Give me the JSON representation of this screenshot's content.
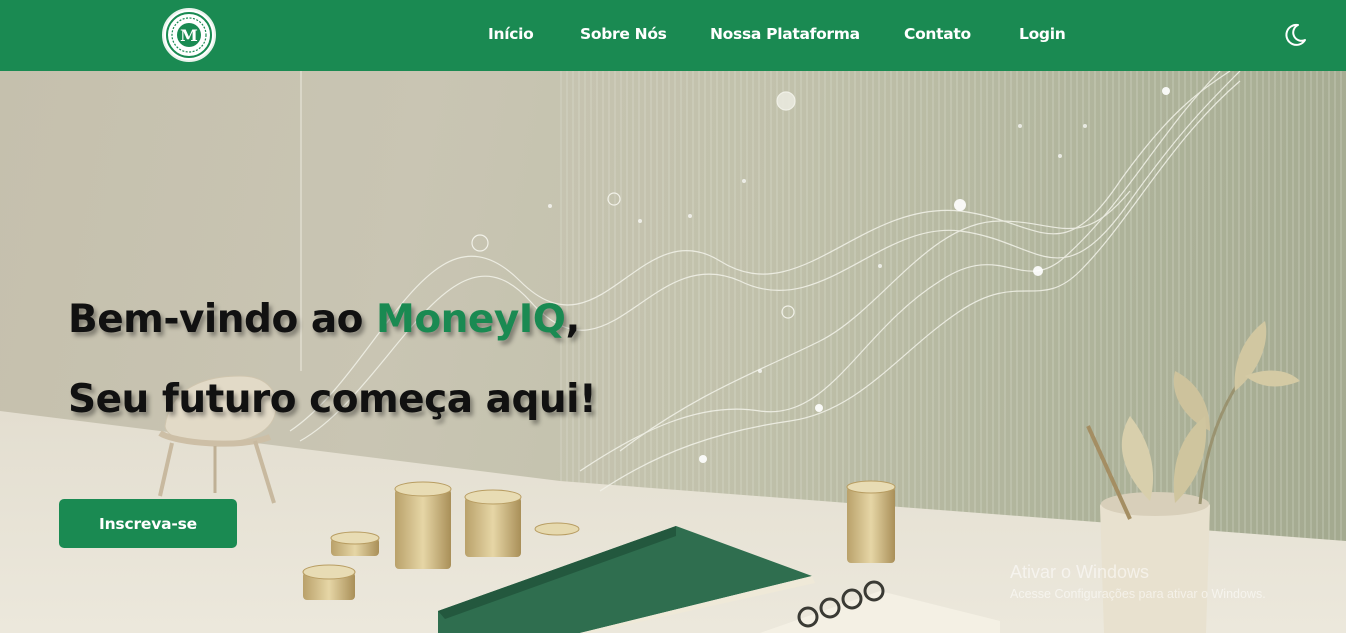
{
  "header": {
    "logo_alt": "M",
    "nav": [
      {
        "label": "Início"
      },
      {
        "label": "Sobre Nós"
      },
      {
        "label": "Nossa Plataforma"
      },
      {
        "label": "Contato"
      },
      {
        "label": "Login"
      }
    ],
    "theme_toggle_icon": "moon-icon"
  },
  "hero": {
    "line1_prefix": "Bem-vindo ao ",
    "line1_brand": "MoneyIQ",
    "line1_suffix": ",",
    "line2": "Seu futuro começa aqui!",
    "cta_label": "Inscreva-se"
  },
  "os_watermark": {
    "title": "Ativar o Windows",
    "subtitle": "Acesse Configurações para ativar o Windows."
  },
  "colors": {
    "brand_green": "#1a8a52",
    "headline": "#111111",
    "background": "#c9c6b5"
  }
}
